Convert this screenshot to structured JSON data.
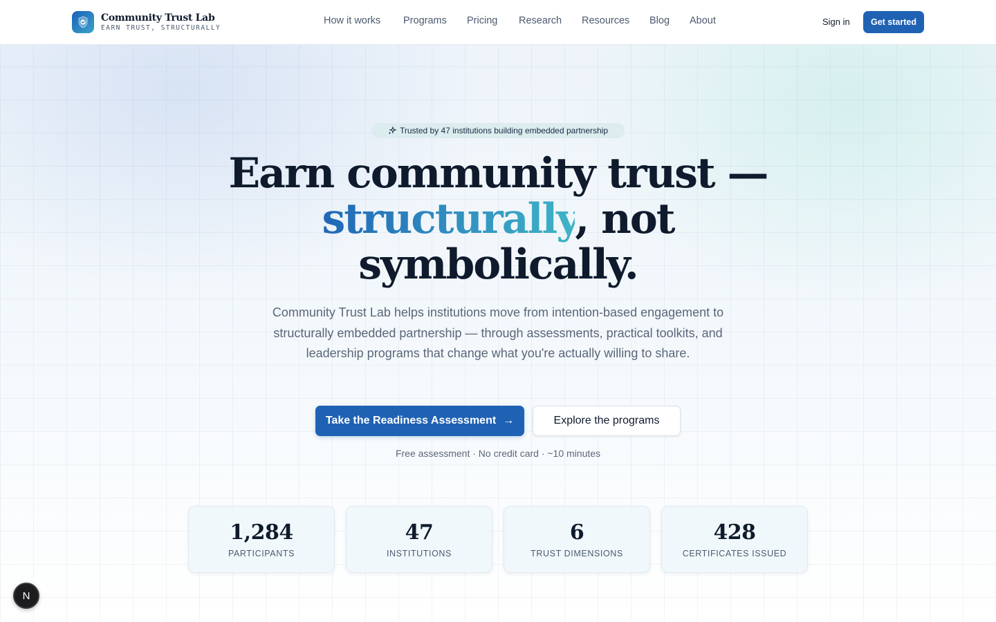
{
  "brand": {
    "name": "Community Trust Lab",
    "tagline": "EARN TRUST, STRUCTURALLY",
    "logo_icon": "shield-check-icon"
  },
  "nav": {
    "items": [
      {
        "label": "How it works"
      },
      {
        "label": "Programs"
      },
      {
        "label": "Pricing"
      },
      {
        "label": "Research"
      },
      {
        "label": "Resources"
      },
      {
        "label": "Blog"
      },
      {
        "label": "About"
      }
    ],
    "sign_in": "Sign in",
    "get_started": "Get started"
  },
  "hero": {
    "badge": "Trusted by 47 institutions building embedded partnership",
    "badge_icon": "sparkles-icon",
    "headline_part1": "Earn community trust —",
    "headline_accent": "structurally",
    "headline_part2": ", not",
    "headline_part3": "symbolically.",
    "subtext": "Community Trust Lab helps institutions move from intention-based engagement to structurally embedded partnership — through assessments, practical toolkits, and leadership programs that change what you're actually willing to share.",
    "primary_cta": "Take the Readiness Assessment",
    "primary_cta_icon": "arrow-right-icon",
    "secondary_cta": "Explore the programs",
    "fineprint": "Free assessment · No credit card · ~10 minutes"
  },
  "stats": [
    {
      "value": "1,284",
      "label": "PARTICIPANTS"
    },
    {
      "value": "47",
      "label": "INSTITUTIONS"
    },
    {
      "value": "6",
      "label": "TRUST DIMENSIONS"
    },
    {
      "value": "428",
      "label": "CERTIFICATES ISSUED"
    }
  ],
  "floating_badge": "N",
  "colors": {
    "primary": "#1f62b4",
    "accent_gradient_start": "#2167b7",
    "accent_gradient_end": "#3fb4c6",
    "text": "#0f1b2d",
    "muted": "#5a6678"
  }
}
